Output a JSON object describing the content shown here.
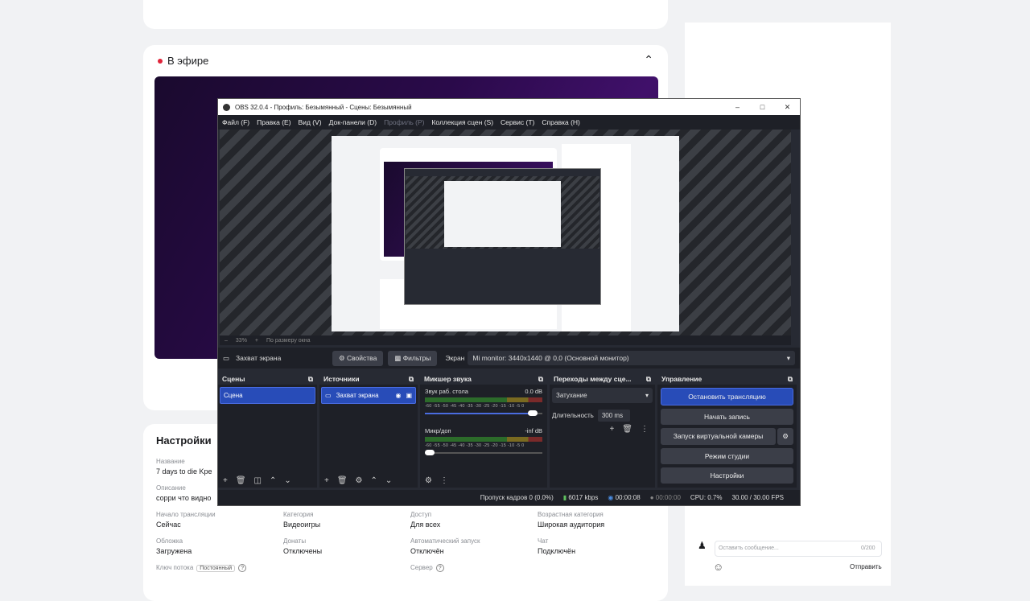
{
  "page": {
    "live_title": "В эфире",
    "settings_title": "Настройки",
    "fields": {
      "name_label": "Название",
      "name_value": "7 days to die Kрe",
      "desc_label": "Описание",
      "desc_value": "сорри что видно",
      "start_label": "Начало трансляции",
      "start_value": "Сейчас",
      "category_label": "Категория",
      "category_value": "Видеоигры",
      "access_label": "Доступ",
      "access_value": "Для всех",
      "age_label": "Возрастная категория",
      "age_value": "Широкая аудитория",
      "cover_label": "Обложка",
      "cover_value": "Загружена",
      "donate_label": "Донаты",
      "donate_value": "Отключены",
      "autostart_label": "Автоматический запуск",
      "autostart_value": "Отключён",
      "chat_label": "Чат",
      "chat_value": "Подключён",
      "key_label": "Ключ потока",
      "key_badge": "Постоянный",
      "server_label": "Сервер"
    },
    "chat": {
      "placeholder": "Оставить сообщение...",
      "count": "0/200",
      "send": "Отправить"
    }
  },
  "obs": {
    "title": "OBS 32.0.4 - Профиль: Безымянный - Сцены: Безымянный",
    "menu": [
      {
        "label": "Файл (F)",
        "disabled": false
      },
      {
        "label": "Правка (E)",
        "disabled": false
      },
      {
        "label": "Вид (V)",
        "disabled": false
      },
      {
        "label": "Док-панели (D)",
        "disabled": false
      },
      {
        "label": "Профиль (P)",
        "disabled": true
      },
      {
        "label": "Коллекция сцен (S)",
        "disabled": false
      },
      {
        "label": "Сервис (T)",
        "disabled": false
      },
      {
        "label": "Справка (H)",
        "disabled": false
      }
    ],
    "zoom": "33%",
    "fit": "По размеру окна",
    "source_name": "Захват экрана",
    "properties_btn": "Свойства",
    "filters_btn": "Фильтры",
    "screen_label": "Экран",
    "screen_value": "Mi monitor: 3440x1440 @ 0,0 (Основной монитор)",
    "docks": {
      "scenes_title": "Сцены",
      "scene_item": "Сцена",
      "sources_title": "Источники",
      "source_item": "Захват экрана",
      "mixer_title": "Микшер звука",
      "ch1_name": "Звук раб. стола",
      "ch1_db": "0.0 dB",
      "ch1_level": 0.92,
      "ch2_name": "Микр/доп",
      "ch2_db": "-inf dB",
      "ch2_level": 0.0,
      "ticks": "-60 -55 -50 -45 -40 -35 -30 -25 -20 -15 -10 -5 0",
      "transitions_title": "Переходы между сце...",
      "transition": "Затухание",
      "duration_label": "Длительность",
      "duration": "300 ms",
      "controls_title": "Управление",
      "stop_stream": "Остановить трансляцию",
      "start_record": "Начать запись",
      "virtual_cam": "Запуск виртуальной камеры",
      "studio_mode": "Режим студии",
      "settings": "Настройки"
    },
    "status": {
      "dropped": "Пропуск кадров 0 (0.0%)",
      "bitrate": "6017 kbps",
      "stream_time": "00:00:08",
      "record_time": "00:00:00",
      "cpu": "CPU: 0.7%",
      "fps": "30.00 / 30.00 FPS"
    }
  }
}
